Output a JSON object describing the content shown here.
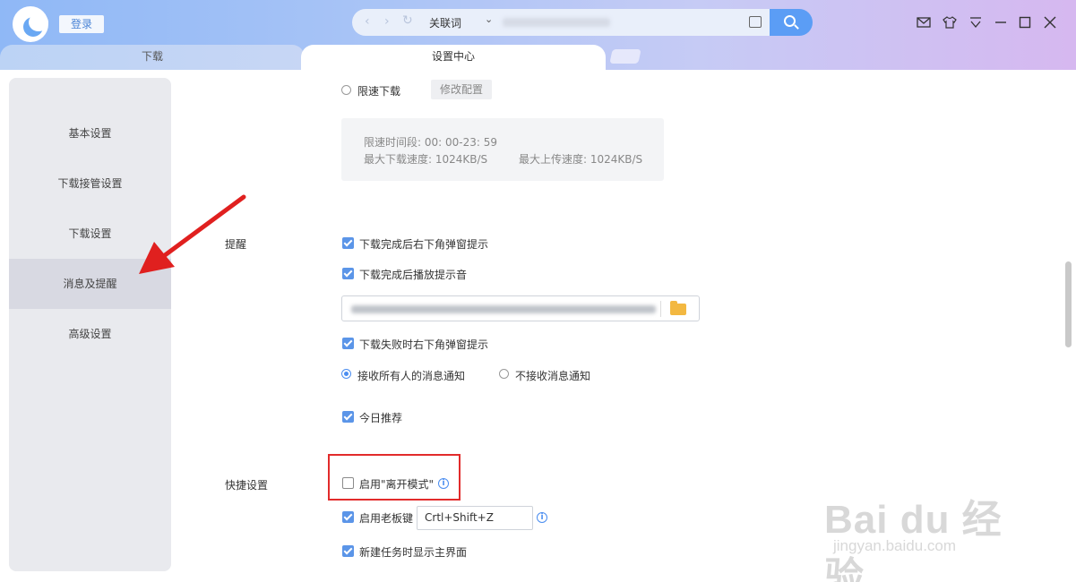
{
  "header": {
    "login_label": "登录",
    "search_keyword": "关联词",
    "tabs": [
      {
        "label": "下载"
      },
      {
        "label": "设置中心"
      }
    ]
  },
  "sidebar": {
    "items": [
      {
        "label": "基本设置"
      },
      {
        "label": "下载接管设置"
      },
      {
        "label": "下载设置"
      },
      {
        "label": "消息及提醒",
        "active": true
      },
      {
        "label": "高级设置"
      }
    ]
  },
  "speed_limit": {
    "radio_label": "限速下载",
    "modify_button": "修改配置",
    "time_range": "限速时间段:  00: 00-23: 59",
    "max_download": "最大下载速度: 1024KB/S",
    "max_upload": "最大上传速度: 1024KB/S"
  },
  "reminder": {
    "section_label": "提醒",
    "popup_on_complete": "下载完成后右下角弹窗提示",
    "sound_on_complete": "下载完成后播放提示音",
    "popup_on_fail": "下载失败时右下角弹窗提示",
    "receive_all": "接收所有人的消息通知",
    "receive_none": "不接收消息通知",
    "today_recommend": "今日推荐"
  },
  "shortcuts": {
    "section_label": "快捷设置",
    "away_mode": "启用\"离开模式\"",
    "boss_key": "启用老板键",
    "boss_key_value": "Crtl+Shift+Z",
    "show_main_on_new": "新建任务时显示主界面"
  },
  "watermark": {
    "brand": "Bai du 经验",
    "url": "jingyan.baidu.com"
  },
  "colors": {
    "accent": "#4a8df0",
    "highlight_box": "#e22b2b",
    "annotation_arrow": "#e0201f"
  }
}
